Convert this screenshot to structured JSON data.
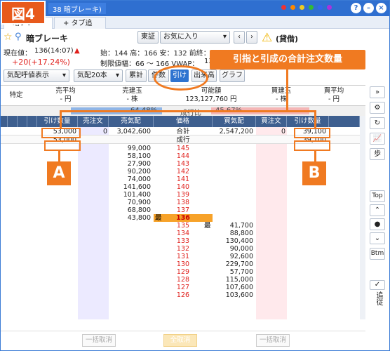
{
  "figure_label": "図4",
  "window": {
    "tab_title": "38 暗ブレーキ)"
  },
  "tabs": [
    "暗ブレーキ",
    "+ タブ追加"
  ],
  "stock": {
    "name": "暗ブレーキ",
    "market_btn": "東証",
    "favorites": "お気に入り",
    "loan": "(貸借)"
  },
  "price_info": {
    "line1_label": "現在値：",
    "line1_value": "136(14:07)",
    "line1_arrow": "▲",
    "line1_rest": "始：144 高：166 安：132 前終：116",
    "line2_change": "+20(+17.24%)",
    "line2_rest": "制限値幅：66 〜 166 VWAP：",
    "vwap_val": "136.2"
  },
  "toolbar": {
    "mode": "気配呼値表示",
    "depth": "気配20本",
    "ruikei": "累計",
    "kazu": "件数",
    "hike": "引け",
    "deki": "出来高",
    "graph": "グラフ"
  },
  "summary": {
    "tokutei": "特定",
    "sell_avg_label": "売平均",
    "sell_avg": "- 円",
    "sell_pos_label": "売建玉",
    "sell_pos": "- 株",
    "avail_label": "可能額",
    "avail": "123,127,760 円",
    "buy_pos_label": "買建玉",
    "buy_pos": "- 株",
    "buy_avg_label": "買平均",
    "buy_avg": "- 円"
  },
  "ratio": {
    "left": "64.48%",
    "mid": "成行比",
    "right": "45.67%"
  },
  "columns": [
    "引け数量",
    "売注文",
    "売気配",
    "価格",
    "買気配",
    "買注文",
    "引け数量"
  ],
  "totals": {
    "left_qty": "53,000",
    "sell_order": "0",
    "sell_quote": "3,042,600",
    "label": "合計",
    "buy_quote": "2,547,200",
    "buy_order": "0",
    "right_qty": "39,100"
  },
  "market_row": {
    "left_qty": "53,000",
    "label": "成行",
    "right_qty": "39,100"
  },
  "asks": [
    {
      "qty": "99,000",
      "price": "145"
    },
    {
      "qty": "58,100",
      "price": "144"
    },
    {
      "qty": "27,900",
      "price": "143"
    },
    {
      "qty": "90,200",
      "price": "142"
    },
    {
      "qty": "74,000",
      "price": "141"
    },
    {
      "qty": "141,600",
      "price": "140"
    },
    {
      "qty": "101,400",
      "price": "139"
    },
    {
      "qty": "70,900",
      "price": "138"
    },
    {
      "qty": "68,800",
      "price": "137"
    },
    {
      "qty": "43,800",
      "price": "136",
      "mark": "最"
    }
  ],
  "bids": [
    {
      "price": "135",
      "qty": "41,700",
      "mark": "最"
    },
    {
      "price": "134",
      "qty": "88,800"
    },
    {
      "price": "133",
      "qty": "130,400"
    },
    {
      "price": "132",
      "qty": "90,000"
    },
    {
      "price": "131",
      "qty": "92,600"
    },
    {
      "price": "130",
      "qty": "229,700"
    },
    {
      "price": "129",
      "qty": "57,700"
    },
    {
      "price": "128",
      "qty": "115,000"
    },
    {
      "price": "127",
      "qty": "107,600"
    },
    {
      "price": "126",
      "qty": "103,600"
    }
  ],
  "callout": "引指と引成の合計注文数量",
  "markers": {
    "a": "A",
    "b": "B"
  },
  "sidebar": {
    "top": "Top",
    "btm": "Btm",
    "track": "追従"
  },
  "bottom": {
    "cancel_left": "一括取消",
    "cancel_all": "全取消",
    "cancel_right": "一括取消"
  }
}
